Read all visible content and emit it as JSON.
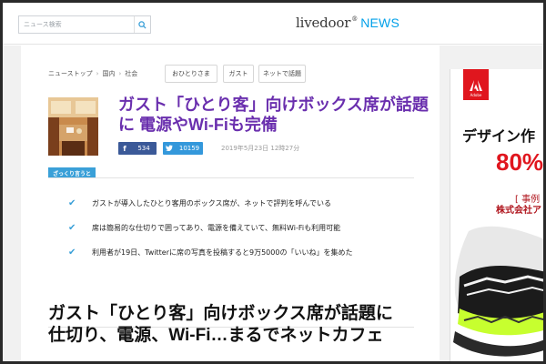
{
  "header": {
    "search_placeholder": "ニュース検索",
    "logo_main": "livedoor",
    "logo_dot": "®",
    "logo_news": "NEWS"
  },
  "breadcrumb": [
    "ニューストップ",
    "国内",
    "社会"
  ],
  "tags": [
    "おひとりさま",
    "ガスト",
    "ネットで話題"
  ],
  "article": {
    "headline": "ガスト「ひとり客」向けボックス席が話題に 電源やWi-Fiも完備",
    "facebook_count": "534",
    "twitter_count": "10159",
    "date": "2019年5月23日 12時27分",
    "summary_label": "ざっくり言うと",
    "summary": [
      "ガストが導入したひとり客用のボックス席が、ネットで評判を呼んでいる",
      "席は簡易的な仕切りで囲ってあり、電源を備えていて、無料Wi-Fiも利用可能",
      "利用者が19日、Twitterに席の写真を投稿すると9万5000の「いいね」を集めた"
    ],
    "title": "ガスト「ひとり客」向けボックス席が話題に　仕切り、電源、Wi-Fi…まるでネットカフェ"
  },
  "ad": {
    "brand": "Adobe",
    "headline": "デザイン作",
    "percent": "80%",
    "sub1": "[ 事例",
    "sub2": "株式会社ア"
  },
  "colors": {
    "headline": "#6a2fae",
    "accent": "#3aa0d8",
    "facebook": "#3b5998",
    "twitter": "#3498db",
    "logo_news": "#00a0e9",
    "ad_red": "#e0161e"
  },
  "icons": [
    "search-icon",
    "facebook-icon",
    "twitter-icon",
    "check-icon",
    "adobe-logo-icon"
  ]
}
